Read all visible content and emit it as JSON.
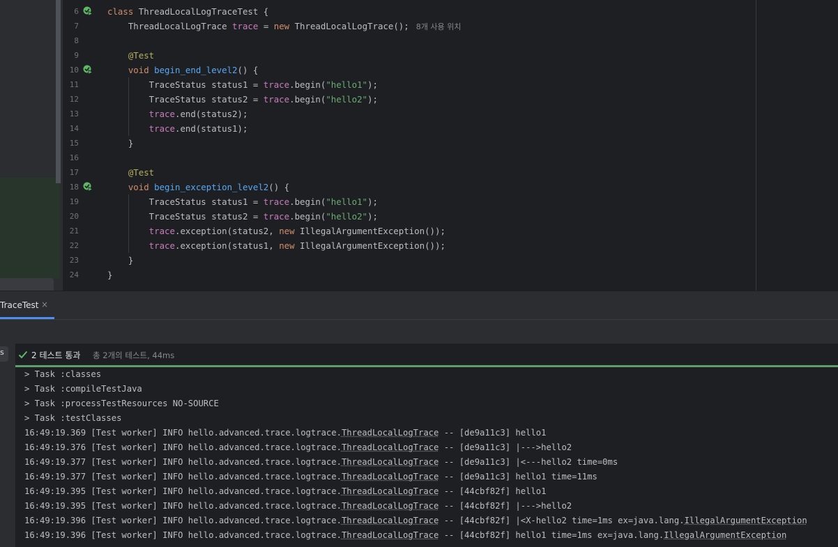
{
  "editor": {
    "lines": [
      {
        "num": "6",
        "tokens": [
          [
            "kw",
            "class "
          ],
          [
            "",
            "ThreadLocalLogTraceTest {"
          ]
        ],
        "run": true
      },
      {
        "num": "7",
        "tokens": [
          [
            "",
            "    ThreadLocalLogTrace "
          ],
          [
            "fld",
            "trace"
          ],
          [
            "",
            " = "
          ],
          [
            "kw",
            "new "
          ],
          [
            "",
            "ThreadLocalLogTrace();"
          ]
        ],
        "hint": "8개 사용 위치"
      },
      {
        "num": "8",
        "tokens": []
      },
      {
        "num": "9",
        "tokens": [
          [
            "ann",
            "    @Test"
          ]
        ]
      },
      {
        "num": "10",
        "tokens": [
          [
            "kw",
            "    void "
          ],
          [
            "fn",
            "begin_end_level2"
          ],
          [
            "",
            "() {"
          ]
        ],
        "run": true
      },
      {
        "num": "11",
        "tokens": [
          [
            "",
            "        TraceStatus status1 = "
          ],
          [
            "fld",
            "trace"
          ],
          [
            "",
            ".begin("
          ],
          [
            "str",
            "\"hello1\""
          ],
          [
            "",
            ");"
          ]
        ]
      },
      {
        "num": "12",
        "tokens": [
          [
            "",
            "        TraceStatus status2 = "
          ],
          [
            "fld",
            "trace"
          ],
          [
            "",
            ".begin("
          ],
          [
            "str",
            "\"hello2\""
          ],
          [
            "",
            ");"
          ]
        ]
      },
      {
        "num": "13",
        "tokens": [
          [
            "fld",
            "        trace"
          ],
          [
            "",
            ".end(status2);"
          ]
        ]
      },
      {
        "num": "14",
        "tokens": [
          [
            "fld",
            "        trace"
          ],
          [
            "",
            ".end(status1);"
          ]
        ]
      },
      {
        "num": "15",
        "tokens": [
          [
            "",
            "    }"
          ]
        ]
      },
      {
        "num": "16",
        "tokens": []
      },
      {
        "num": "17",
        "tokens": [
          [
            "ann",
            "    @Test"
          ]
        ]
      },
      {
        "num": "18",
        "tokens": [
          [
            "kw",
            "    void "
          ],
          [
            "fn",
            "begin_exception_level2"
          ],
          [
            "",
            "() {"
          ]
        ],
        "run": true
      },
      {
        "num": "19",
        "tokens": [
          [
            "",
            "        TraceStatus status1 = "
          ],
          [
            "fld",
            "trace"
          ],
          [
            "",
            ".begin("
          ],
          [
            "str",
            "\"hello1\""
          ],
          [
            "",
            ");"
          ]
        ]
      },
      {
        "num": "20",
        "tokens": [
          [
            "",
            "        TraceStatus status2 = "
          ],
          [
            "fld",
            "trace"
          ],
          [
            "",
            ".begin("
          ],
          [
            "str",
            "\"hello2\""
          ],
          [
            "",
            ");"
          ]
        ]
      },
      {
        "num": "21",
        "tokens": [
          [
            "fld",
            "        trace"
          ],
          [
            "",
            ".exception(status2, "
          ],
          [
            "kw",
            "new "
          ],
          [
            "",
            "IllegalArgumentException());"
          ]
        ]
      },
      {
        "num": "22",
        "tokens": [
          [
            "fld",
            "        trace"
          ],
          [
            "",
            ".exception(status1, "
          ],
          [
            "kw",
            "new "
          ],
          [
            "",
            "IllegalArgumentException());"
          ]
        ]
      },
      {
        "num": "23",
        "tokens": [
          [
            "",
            "    }"
          ]
        ]
      },
      {
        "num": "24",
        "tokens": [
          [
            "",
            "}"
          ]
        ]
      }
    ]
  },
  "run_panel": {
    "tab_label": "TraceTest",
    "tab_close": "×",
    "tree_selected_label": "s",
    "status_text": "2 테스트 통과",
    "status_sub": "총 2개의 테스트, 44ms",
    "console_lines": [
      [
        [
          "",
          "> Task :classes"
        ]
      ],
      [
        [
          "",
          "> Task :compileTestJava"
        ]
      ],
      [
        [
          "",
          "> Task :processTestResources NO-SOURCE"
        ]
      ],
      [
        [
          "",
          "> Task :testClasses"
        ]
      ],
      [
        [
          "",
          "16:49:19.369 [Test worker] INFO hello.advanced.trace.logtrace."
        ],
        [
          "ul",
          "ThreadLocalLogTrace"
        ],
        [
          "",
          " -- [de9a11c3] hello1"
        ]
      ],
      [
        [
          "",
          "16:49:19.376 [Test worker] INFO hello.advanced.trace.logtrace."
        ],
        [
          "ul",
          "ThreadLocalLogTrace"
        ],
        [
          "",
          " -- [de9a11c3] |--->hello2"
        ]
      ],
      [
        [
          "",
          "16:49:19.377 [Test worker] INFO hello.advanced.trace.logtrace."
        ],
        [
          "ul",
          "ThreadLocalLogTrace"
        ],
        [
          "",
          " -- [de9a11c3] |<---hello2 time=0ms"
        ]
      ],
      [
        [
          "",
          "16:49:19.377 [Test worker] INFO hello.advanced.trace.logtrace."
        ],
        [
          "ul",
          "ThreadLocalLogTrace"
        ],
        [
          "",
          " -- [de9a11c3] hello1 time=11ms"
        ]
      ],
      [
        [
          "",
          "16:49:19.395 [Test worker] INFO hello.advanced.trace.logtrace."
        ],
        [
          "ul",
          "ThreadLocalLogTrace"
        ],
        [
          "",
          " -- [44cbf82f] hello1"
        ]
      ],
      [
        [
          "",
          "16:49:19.395 [Test worker] INFO hello.advanced.trace.logtrace."
        ],
        [
          "ul",
          "ThreadLocalLogTrace"
        ],
        [
          "",
          " -- [44cbf82f] |--->hello2"
        ]
      ],
      [
        [
          "",
          "16:49:19.396 [Test worker] INFO hello.advanced.trace.logtrace."
        ],
        [
          "ul",
          "ThreadLocalLogTrace"
        ],
        [
          "",
          " -- [44cbf82f] |<X-hello2 time=1ms ex=java.lang."
        ],
        [
          "ul",
          "IllegalArgumentException"
        ]
      ],
      [
        [
          "",
          "16:49:19.396 [Test worker] INFO hello.advanced.trace.logtrace."
        ],
        [
          "ul",
          "ThreadLocalLogTrace"
        ],
        [
          "",
          " -- [44cbf82f] hello1 time=1ms ex=java.lang."
        ],
        [
          "ul",
          "IllegalArgumentException"
        ]
      ]
    ]
  },
  "colors": {
    "keyword": "#cf8e6d",
    "function": "#56a8f5",
    "field": "#c77dbb",
    "string": "#6aab73",
    "annotation": "#b3ae60",
    "pass_green": "#5c9f6a",
    "accent": "#4e8ff0"
  },
  "icons": {
    "run_gutter": "run-test-passed-icon",
    "status": "check-icon",
    "close": "close-icon"
  }
}
